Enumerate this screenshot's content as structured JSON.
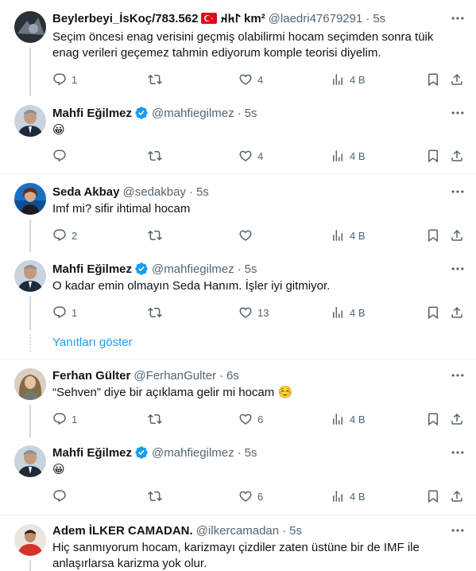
{
  "colors": {
    "accent": "#1d9bf0",
    "muted": "#536471",
    "text": "#0f1419",
    "divider": "#eff3f4",
    "thread": "#cfd9de"
  },
  "show_replies_label": "Yanıtları göster",
  "tweets": [
    {
      "name": "Beylerbeyi_İsKoç/783.562",
      "flag": "turkey-flag",
      "extra": "𐰃𐱅𐰴 km²",
      "handle": "@laedri47679291",
      "time": "5s",
      "text": "Seçim öncesi enag verisini geçmiş olabilirmi hocam seçimden sonra tüik enag verileri geçemez tahmin ediyorum komple teorisi diyelim.",
      "reply": "1",
      "retweet": "",
      "like": "4",
      "views": "4 B"
    },
    {
      "name": "Mahfi Eğilmez",
      "verified": true,
      "handle": "@mahfiegilmez",
      "time": "5s",
      "text": "😀",
      "reply": "",
      "retweet": "",
      "like": "4",
      "views": "4 B"
    },
    {
      "name": "Seda Akbay",
      "handle": "@sedakbay",
      "time": "5s",
      "text": "Imf mi? sifir ihtimal hocam",
      "reply": "2",
      "retweet": "",
      "like": "",
      "views": "4 B"
    },
    {
      "name": "Mahfi Eğilmez",
      "verified": true,
      "handle": "@mahfiegilmez",
      "time": "5s",
      "text": "O kadar emin olmayın Seda Hanım. İşler iyi gitmiyor.",
      "reply": "1",
      "retweet": "",
      "like": "13",
      "views": "4 B"
    },
    {
      "name": "Ferhan Gülter",
      "handle": "@FerhanGulter",
      "time": "6s",
      "text": "“Sehven” diye bir açıklama gelir mi hocam ☺️",
      "reply": "1",
      "retweet": "",
      "like": "6",
      "views": "4 B"
    },
    {
      "name": "Mahfi Eğilmez",
      "verified": true,
      "handle": "@mahfiegilmez",
      "time": "5s",
      "text": "😀",
      "reply": "",
      "retweet": "",
      "like": "6",
      "views": "4 B"
    },
    {
      "name": "Adem İLKER CAMADAN.",
      "handle": "@ilkercamadan",
      "time": "5s",
      "text": "Hiç sanmıyorum hocam, karizmayı çizdiler zaten üstüne bir de IMF ile anlaşırlarsa karizma yok olur.",
      "reply": "",
      "retweet": "",
      "like": "",
      "views": ""
    }
  ]
}
